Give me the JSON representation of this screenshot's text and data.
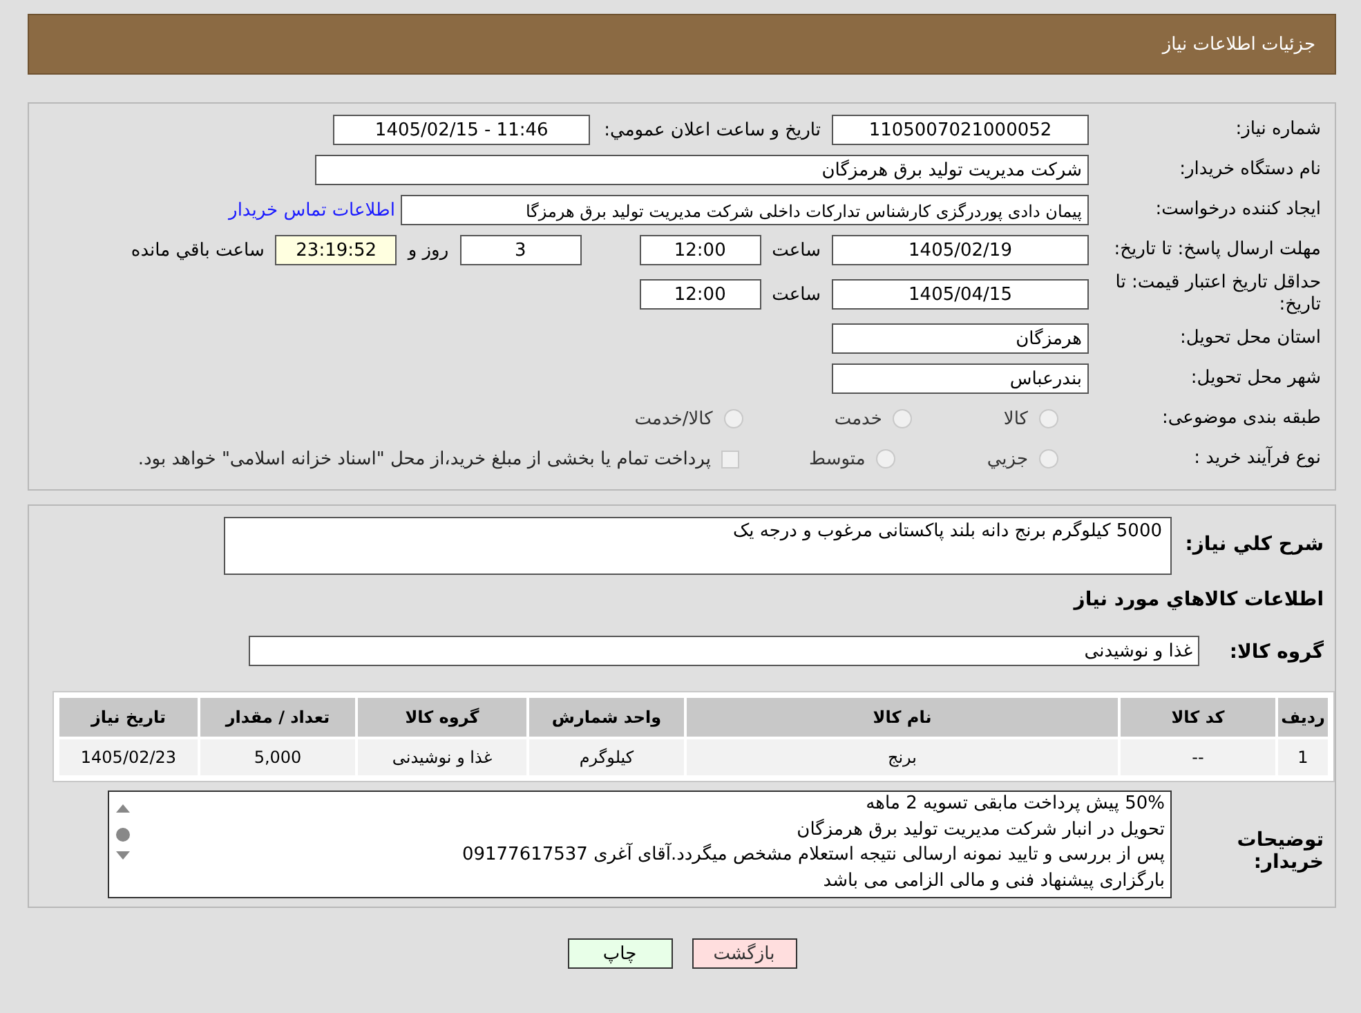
{
  "header": {
    "title": "جزئیات اطلاعات نیاز"
  },
  "details": {
    "need_number": {
      "label": "شماره نیاز:",
      "value": "1105007021000052"
    },
    "announce": {
      "label": "تاريخ و ساعت اعلان عمومي:",
      "value": "1405/02/15 - 11:46"
    },
    "buyer": {
      "label": "نام دستگاه خریدار:",
      "value": "شرکت مدیریت تولید برق هرمزگان"
    },
    "requester": {
      "label": "ایجاد کننده درخواست:",
      "value": "پیمان دادی پوردرگزی کارشناس تدارکات داخلی شرکت مدیریت تولید برق هرمزگا",
      "link": "اطلاعات تماس خریدار"
    },
    "deadline": {
      "label": "مهلت ارسال پاسخ: تا تاریخ:",
      "date": "1405/02/19",
      "time_label": "ساعت",
      "time": "12:00",
      "days": "3",
      "days_label": "روز و",
      "remaining": "23:19:52",
      "remaining_label": "ساعت باقي مانده"
    },
    "validity": {
      "label": "حداقل تاریخ اعتبار قیمت: تا تاریخ:",
      "date": "1405/04/15",
      "time_label": "ساعت",
      "time": "12:00"
    },
    "province": {
      "label": "استان محل تحویل:",
      "value": "هرمزگان"
    },
    "city": {
      "label": "شهر محل تحویل:",
      "value": "بندرعباس"
    },
    "category": {
      "label": "طبقه بندی موضوعی:",
      "options": [
        {
          "label": "کالا",
          "selected": false
        },
        {
          "label": "خدمت",
          "selected": false
        },
        {
          "label": "کالا/خدمت",
          "selected": false
        }
      ]
    },
    "process": {
      "label": "نوع فرآیند خرید :",
      "options": [
        {
          "label": "جزيي",
          "selected": false
        },
        {
          "label": "متوسط",
          "selected": false
        }
      ],
      "payment_checkbox": {
        "label": "پرداخت تمام یا بخشی از مبلغ خرید،از محل \"اسناد خزانه اسلامی\" خواهد بود.",
        "checked": false
      }
    }
  },
  "need": {
    "summary_label": "شرح کلي نياز:",
    "summary": "5000 کیلوگرم برنج دانه بلند پاکستانی مرغوب و درجه یک",
    "goods_heading": "اطلاعات کالاهاي مورد نياز",
    "group_label": "گروه کالا:",
    "group": "غذا و نوشیدنی",
    "table": {
      "columns": [
        "ردیف",
        "کد کالا",
        "نام کالا",
        "واحد شمارش",
        "گروه کالا",
        "تعداد / مقدار",
        "تاریخ نیاز"
      ],
      "rows": [
        [
          "1",
          "--",
          "برنج",
          "کیلوگرم",
          "غذا و نوشیدنی",
          "5,000",
          "1405/02/23"
        ]
      ]
    },
    "notes_label": "توضیحات خریدار:",
    "notes": [
      "50% پیش پرداخت مابقی تسویه 2 ماهه",
      "تحویل در انبار شرکت مدیریت تولید برق هرمزگان",
      "پس از بررسی و تایید نمونه ارسالی نتیجه استعلام مشخص میگردد.آقای آغری 09177617537",
      "بارگزاری پیشنهاد فنی و مالی الزامی می باشد"
    ]
  },
  "buttons": [
    {
      "label": "بازگشت",
      "kind": "back"
    },
    {
      "label": "چاپ",
      "kind": "print"
    }
  ]
}
